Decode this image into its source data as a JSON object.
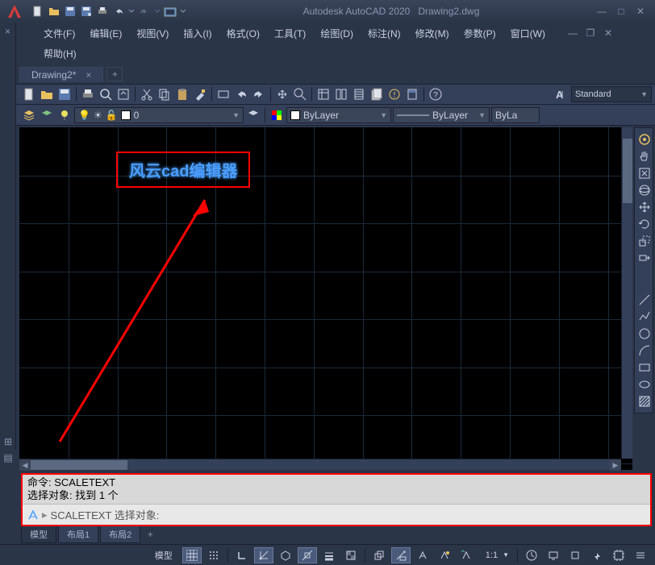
{
  "title": {
    "app": "Autodesk AutoCAD 2020",
    "file": "Drawing2.dwg"
  },
  "menus": {
    "file": "文件(F)",
    "edit": "编辑(E)",
    "view": "视图(V)",
    "insert": "插入(I)",
    "format": "格式(O)",
    "tools": "工具(T)",
    "draw": "绘图(D)",
    "dimension": "标注(N)",
    "modify": "修改(M)",
    "param": "参数(P)",
    "window": "窗口(W)",
    "help": "帮助(H)"
  },
  "doc_tab": {
    "name": "Drawing2*",
    "close": "×",
    "add": "+"
  },
  "style_dd": "Standard",
  "layer": {
    "current": "0",
    "prop1": "ByLayer",
    "prop2": "ByLayer",
    "prop3": "ByLa"
  },
  "canvas_text": "风云cad编辑器",
  "cmd": {
    "hist1": "命令: SCALETEXT",
    "hist2": "选择对象: 找到 1 个",
    "prompt": "SCALETEXT 选择对象:"
  },
  "bottom_tabs": {
    "model": "模型",
    "layout1": "布局1",
    "layout2": "布局2",
    "add": "+"
  },
  "status": {
    "model": "模型",
    "scale": "1:1"
  },
  "icons": {
    "new": "new-icon",
    "open": "open-icon",
    "save": "save-icon",
    "saveas": "saveas-icon",
    "print": "print-icon",
    "undo": "undo-icon",
    "redo": "redo-icon"
  }
}
